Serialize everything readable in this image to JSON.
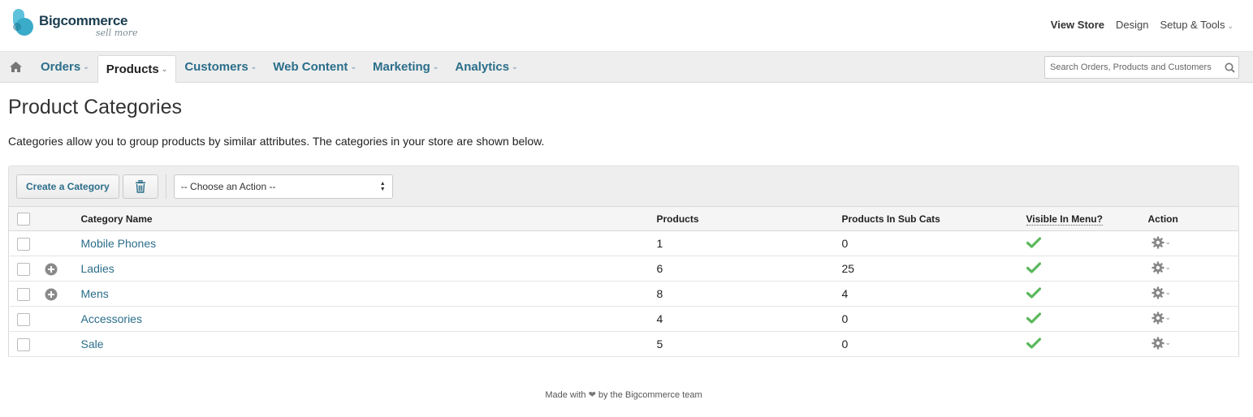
{
  "brand": {
    "name": "Bigcommerce",
    "tagline": "sell more"
  },
  "top_links": {
    "view_store": "View Store",
    "design": "Design",
    "setup_tools": "Setup & Tools"
  },
  "nav": {
    "items": [
      {
        "label": "Orders"
      },
      {
        "label": "Products"
      },
      {
        "label": "Customers"
      },
      {
        "label": "Web Content"
      },
      {
        "label": "Marketing"
      },
      {
        "label": "Analytics"
      }
    ],
    "active": "Products"
  },
  "search": {
    "placeholder": "Search Orders, Products and Customers"
  },
  "page": {
    "title": "Product Categories",
    "description": "Categories allow you to group products by similar attributes. The categories in your store are shown below."
  },
  "toolbar": {
    "create_label": "Create a Category",
    "action_select": "-- Choose an Action --"
  },
  "table": {
    "headers": {
      "name": "Category Name",
      "products": "Products",
      "sub_cats": "Products In Sub Cats",
      "visible": "Visible In Menu?",
      "action": "Action"
    },
    "rows": [
      {
        "name": "Mobile Phones",
        "products": "1",
        "sub_cats": "0",
        "expandable": false,
        "visible": true
      },
      {
        "name": "Ladies",
        "products": "6",
        "sub_cats": "25",
        "expandable": true,
        "visible": true
      },
      {
        "name": "Mens",
        "products": "8",
        "sub_cats": "4",
        "expandable": true,
        "visible": true
      },
      {
        "name": "Accessories",
        "products": "4",
        "sub_cats": "0",
        "expandable": false,
        "visible": true
      },
      {
        "name": "Sale",
        "products": "5",
        "sub_cats": "0",
        "expandable": false,
        "visible": true
      }
    ]
  },
  "footer": {
    "prefix": "Made with",
    "suffix": "by the Bigcommerce team"
  },
  "colors": {
    "link": "#2b6e8a",
    "check": "#5cb85c",
    "brand": "#3aabc9"
  }
}
